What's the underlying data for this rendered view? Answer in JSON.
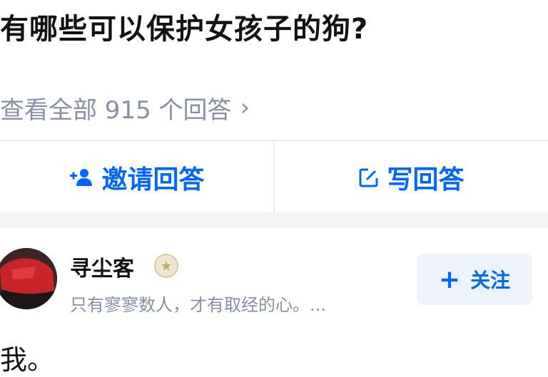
{
  "question": {
    "title": "有哪些可以保护女孩子的狗?"
  },
  "answers_link": {
    "label": "查看全部 915 个回答",
    "chevron": "›"
  },
  "actions": {
    "invite_label": "邀请回答",
    "write_label": "写回答"
  },
  "author": {
    "name": "寻尘客",
    "bio": "只有寥寥数人，才有取经的心。...",
    "badge_icon": "badge-icon"
  },
  "follow": {
    "label": "关注",
    "icon": "+"
  },
  "answer": {
    "text": "我。"
  },
  "colors": {
    "accent": "#0066ff",
    "muted": "#8590a6",
    "divider": "#f3f3f5"
  }
}
